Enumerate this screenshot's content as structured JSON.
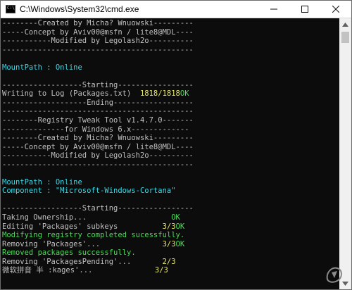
{
  "window": {
    "title": "C:\\Windows\\System32\\cmd.exe",
    "icon_label": "C:\\",
    "minimize_icon": "minimize-icon",
    "maximize_icon": "maximize-icon",
    "close_icon": "close-icon"
  },
  "colors": {
    "background": "#0c0c0c",
    "default_text": "#c0c0c0",
    "cyan": "#3bd6e4",
    "yellow": "#e7e76b",
    "green": "#4fd85c"
  },
  "console": {
    "lines": [
      [
        {
          "t": "--------Created by Micha? Wnuowski---------",
          "c": ""
        }
      ],
      [
        {
          "t": "-----Concept by Aviv00@msfn / lite8@MDL----",
          "c": ""
        }
      ],
      [
        {
          "t": "-----------Modified by Legolash2o----------",
          "c": ""
        }
      ],
      [
        {
          "t": "-------------------------------------------",
          "c": ""
        }
      ],
      [
        {
          "t": "",
          "c": ""
        }
      ],
      [
        {
          "t": "MountPath : Online",
          "c": "cyan"
        }
      ],
      [
        {
          "t": "",
          "c": ""
        }
      ],
      [
        {
          "t": "------------------Starting-----------------",
          "c": ""
        }
      ],
      [
        {
          "t": "Writing to Log (Packages.txt)  ",
          "c": ""
        },
        {
          "t": "1818/1818",
          "c": "yellow"
        },
        {
          "t": "OK",
          "c": "green"
        }
      ],
      [
        {
          "t": "-------------------Ending------------------",
          "c": ""
        }
      ],
      [
        {
          "t": "-------------------------------------------",
          "c": ""
        }
      ],
      [
        {
          "t": "--------Registry Tweak Tool v1.4.7.0-------",
          "c": ""
        }
      ],
      [
        {
          "t": "--------------for Windows 6.x-------------",
          "c": ""
        }
      ],
      [
        {
          "t": "--------Created by Micha? Wnuowski---------",
          "c": ""
        }
      ],
      [
        {
          "t": "-----Concept by Aviv00@msfn / lite8@MDL----",
          "c": ""
        }
      ],
      [
        {
          "t": "-----------Modified by Legolash2o----------",
          "c": ""
        }
      ],
      [
        {
          "t": "-------------------------------------------",
          "c": ""
        }
      ],
      [
        {
          "t": "",
          "c": ""
        }
      ],
      [
        {
          "t": "MountPath : Online",
          "c": "cyan"
        }
      ],
      [
        {
          "t": "Component : \"Microsoft-Windows-Cortana\"",
          "c": "cyan"
        }
      ],
      [
        {
          "t": "",
          "c": ""
        }
      ],
      [
        {
          "t": "------------------Starting-----------------",
          "c": ""
        }
      ],
      [
        {
          "t": "Taking Ownership...                   ",
          "c": ""
        },
        {
          "t": "OK",
          "c": "green"
        }
      ],
      [
        {
          "t": "Editing 'Packages' subkeys          ",
          "c": ""
        },
        {
          "t": "3/3",
          "c": "yellow"
        },
        {
          "t": "OK",
          "c": "green"
        }
      ],
      [
        {
          "t": "Modifying registry completed sucessfully.",
          "c": "green"
        }
      ],
      [
        {
          "t": "Removing 'Packages'...              ",
          "c": ""
        },
        {
          "t": "3/3",
          "c": "yellow"
        },
        {
          "t": "OK",
          "c": "green"
        }
      ],
      [
        {
          "t": "Removed packages successfully.",
          "c": "green"
        }
      ],
      [
        {
          "t": "Removing 'PackagesPending'...       ",
          "c": ""
        },
        {
          "t": "2/3",
          "c": "yellow"
        }
      ],
      [
        {
          "t": "微软拼音 半 :kages'...              ",
          "c": ""
        },
        {
          "t": "3/3",
          "c": "yellow"
        }
      ]
    ]
  }
}
